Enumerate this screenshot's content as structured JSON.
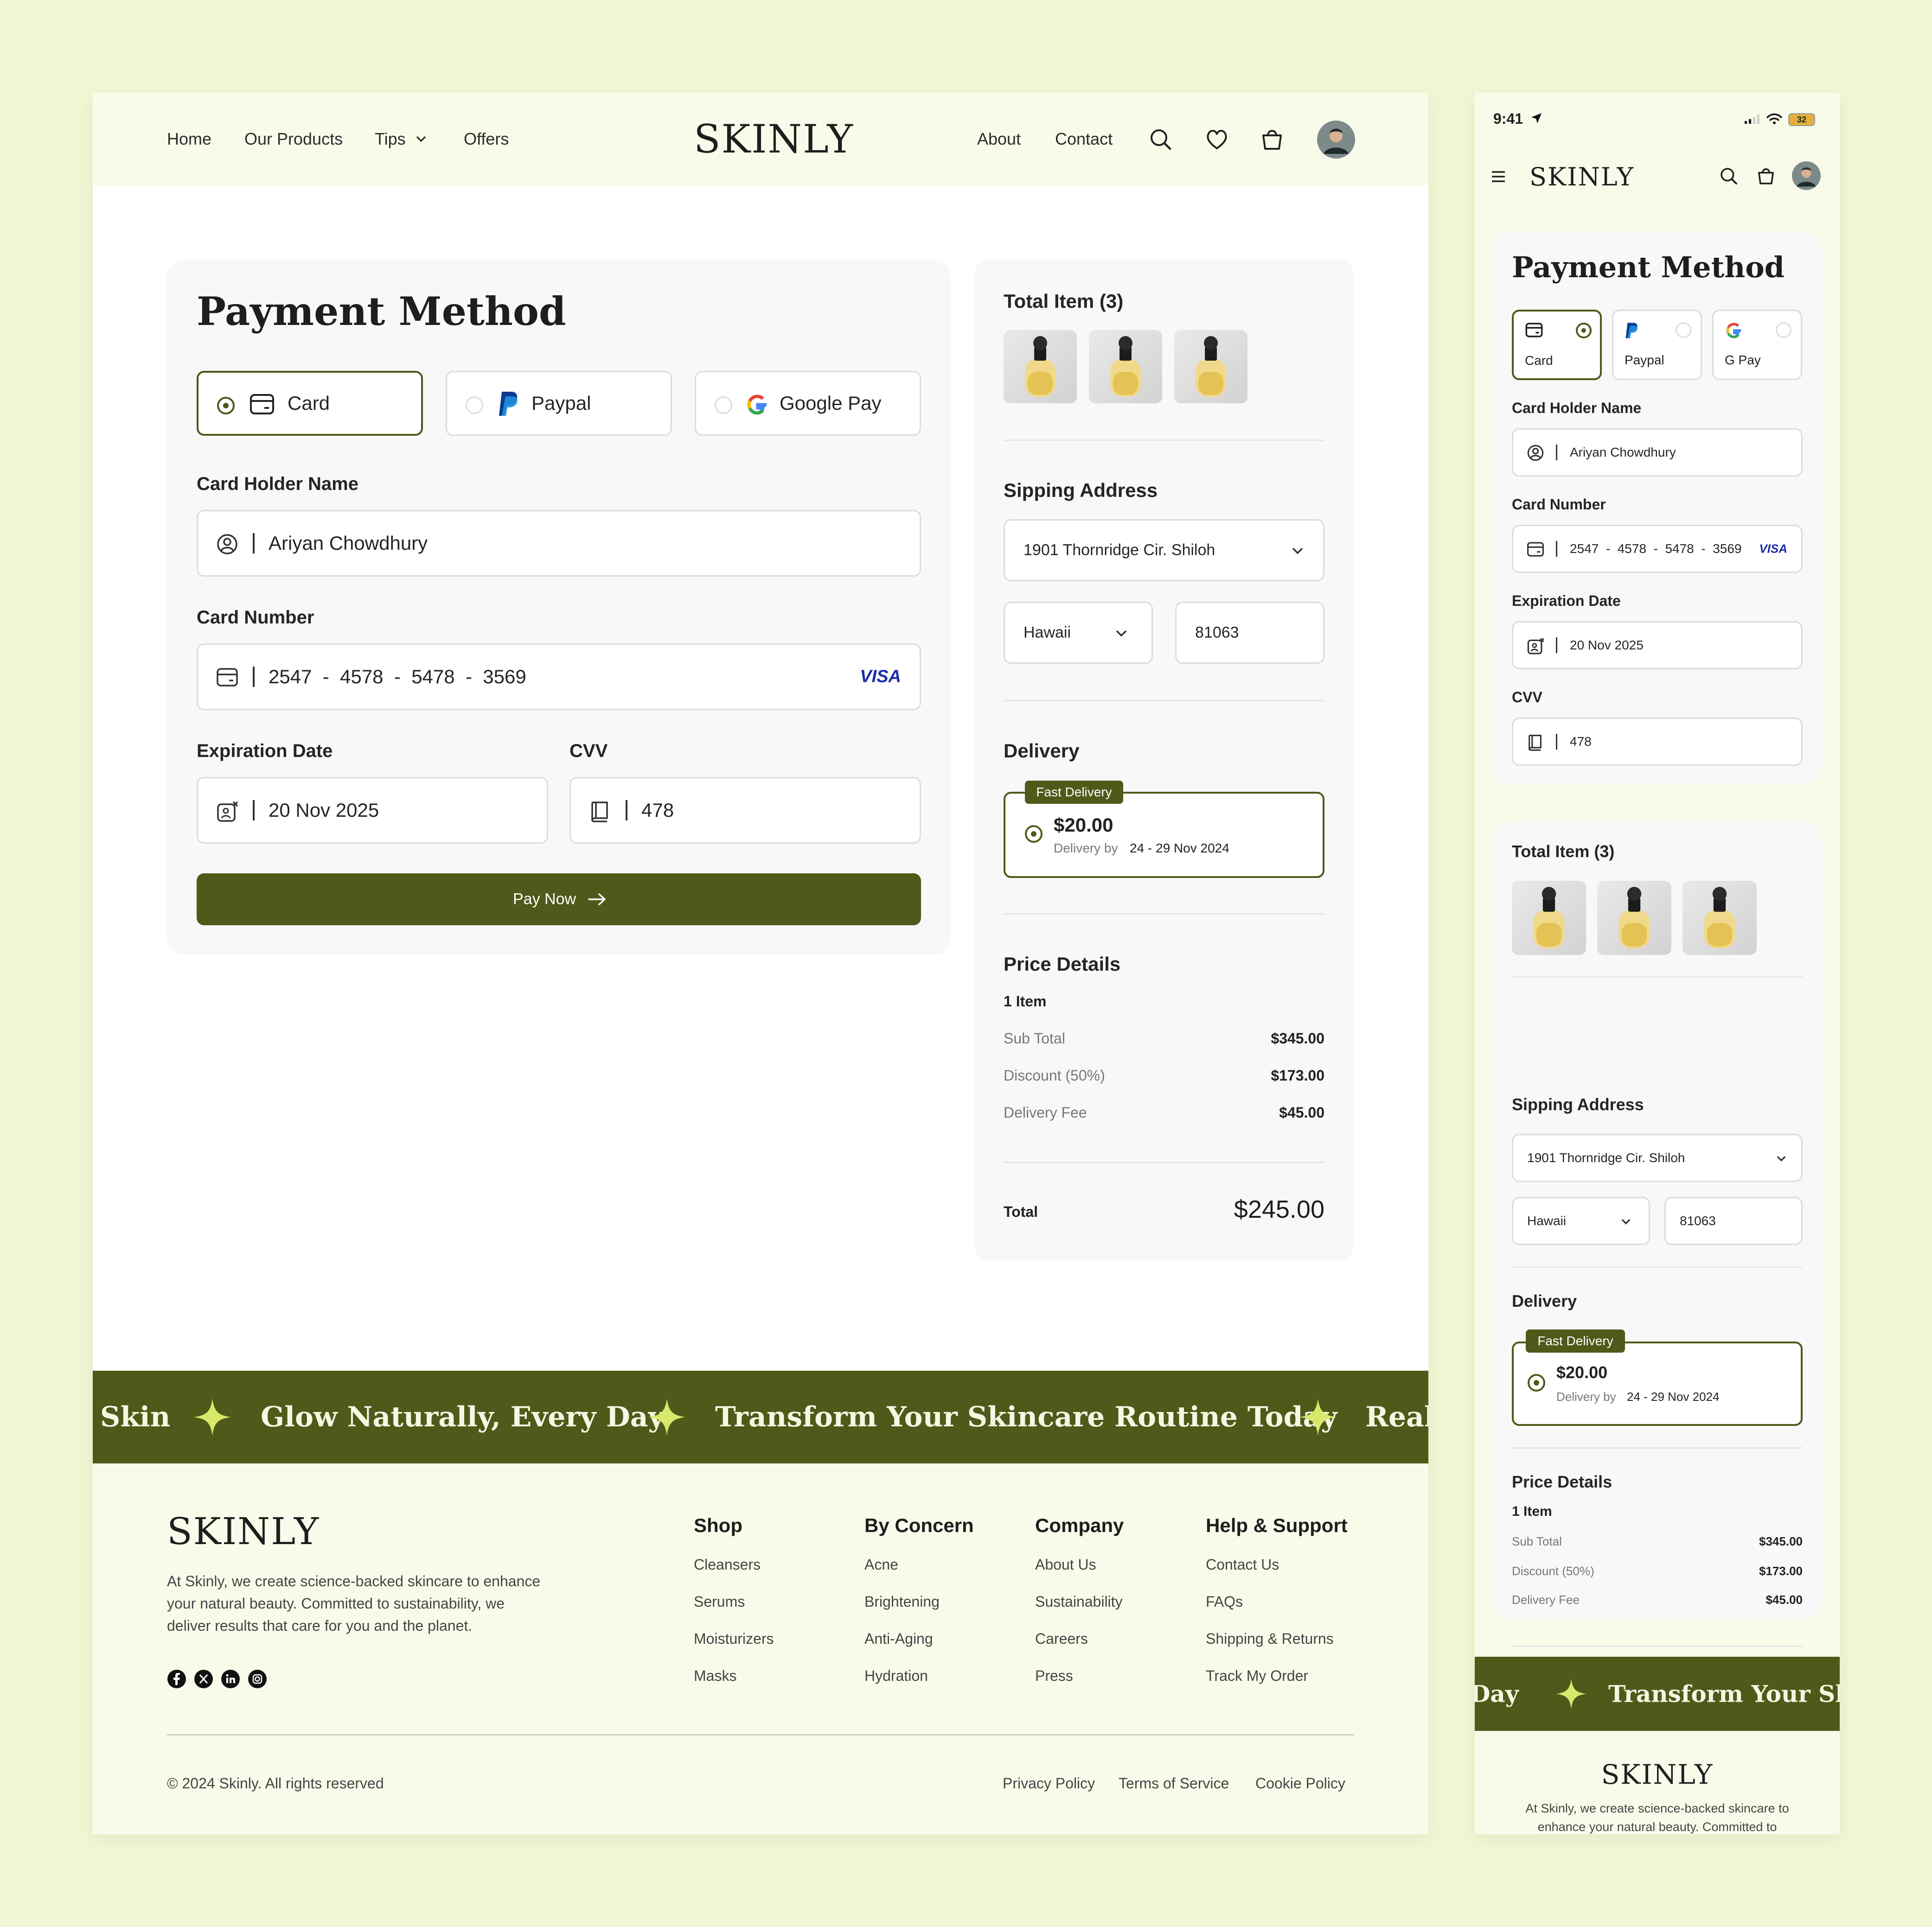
{
  "brand": {
    "logo": "SKINLY",
    "accent": "#4d5a1a",
    "star": "#d8e86a",
    "background": "#f3f6d6"
  },
  "nav": {
    "home": "Home",
    "products": "Our Products",
    "tips": "Tips",
    "offers": "Offers",
    "about": "About",
    "contact": "Contact"
  },
  "payment": {
    "title": "Payment Method",
    "methods": [
      {
        "label": "Card",
        "selected": true
      },
      {
        "label": "Paypal",
        "selected": false
      },
      {
        "label": "Google Pay",
        "selected": false
      }
    ],
    "holder_label": "Card Holder Name",
    "holder_value": "Ariyan Chowdhury",
    "number_label": "Card Number",
    "number_value": "2547  -  4578  -  5478  -  3569",
    "card_brand": "VISA",
    "exp_label": "Expiration Date",
    "exp_value": "20 Nov 2025",
    "cvv_label": "CVV",
    "cvv_value": "478",
    "pay_button": "Pay Now"
  },
  "summary": {
    "items_title": "Total Item (3)",
    "address_title": "Sipping Address",
    "address": "1901 Thornridge Cir. Shiloh",
    "state": "Hawaii",
    "zip": "81063",
    "delivery_title": "Delivery",
    "delivery_badge": "Fast Delivery",
    "delivery_price": "$20.00",
    "delivery_by": "Delivery by",
    "delivery_dates": "24 - 29 Nov 2024",
    "price_title": "Price Details",
    "item_count": "1 Item",
    "rows": [
      {
        "label": "Sub Total",
        "value": "$345.00"
      },
      {
        "label": "Discount (50%)",
        "value": "$173.00"
      },
      {
        "label": "Delivery Fee",
        "value": "$45.00"
      }
    ],
    "total_label": "Total",
    "total_value": "$245.00"
  },
  "banner": {
    "items": [
      "Skin",
      "Glow Naturally, Every Day",
      "Transform Your Skincare Routine Today",
      "Real"
    ]
  },
  "footer": {
    "about": "At Skinly, we create science-backed skincare to enhance your natural beauty. Committed to sustainability, we deliver results that care for you and the planet.",
    "columns": [
      {
        "title": "Shop",
        "links": [
          "Cleansers",
          "Serums",
          "Moisturizers",
          "Masks"
        ]
      },
      {
        "title": "By Concern",
        "links": [
          "Acne",
          "Brightening",
          "Anti-Aging",
          "Hydration"
        ]
      },
      {
        "title": "Company",
        "links": [
          "About Us",
          "Sustainability",
          "Careers",
          "Press"
        ]
      },
      {
        "title": "Help & Support",
        "links": [
          "Contact Us",
          "FAQs",
          "Shipping & Returns",
          "Track My Order"
        ]
      }
    ],
    "copyright": "© 2024 Skinly. All rights reserved",
    "legal": [
      "Privacy Policy",
      "Terms of Service",
      "Cookie Policy"
    ]
  },
  "mobile": {
    "time": "9:41",
    "battery": "32",
    "methods": [
      "Card",
      "Paypal",
      "G Pay"
    ],
    "number_value": "2547  -  4578  -  5478  -  3569",
    "banner": [
      "Day",
      "Transform Your Ski"
    ],
    "about_line1": "At Skinly, we create science-backed skincare to",
    "about_line2": "enhance your natural beauty. Committed to"
  }
}
